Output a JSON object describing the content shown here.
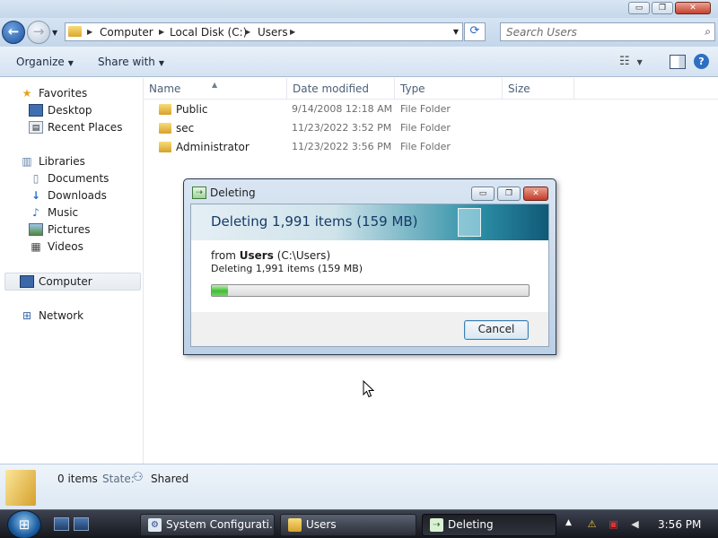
{
  "window": {
    "controls": {
      "minimize": "▭",
      "maximize": "❐",
      "close": "✕"
    }
  },
  "navigation": {
    "back_glyph": "←",
    "forward_glyph": "→",
    "breadcrumbs": [
      "Computer",
      "Local Disk (C:)",
      "Users"
    ],
    "search_placeholder": "Search Users"
  },
  "toolbar": {
    "organize_label": "Organize",
    "share_label": "Share with",
    "help_glyph": "?"
  },
  "nav_pane": {
    "favorites_label": "Favorites",
    "favorites": [
      "Desktop",
      "Recent Places"
    ],
    "libraries_label": "Libraries",
    "libraries": [
      "Documents",
      "Downloads",
      "Music",
      "Pictures",
      "Videos"
    ],
    "computer_label": "Computer",
    "network_label": "Network"
  },
  "file_list": {
    "columns": [
      "Name",
      "Date modified",
      "Type",
      "Size"
    ],
    "rows": [
      {
        "name": "Public",
        "date": "9/14/2008 12:18 AM",
        "type": "File Folder"
      },
      {
        "name": "sec",
        "date": "11/23/2022 3:52 PM",
        "type": "File Folder"
      },
      {
        "name": "Administrator",
        "date": "11/23/2022 3:56 PM",
        "type": "File Folder"
      }
    ]
  },
  "details_pane": {
    "items_count": "0 items",
    "state_label": "State:",
    "state_value": "Shared"
  },
  "dialog": {
    "title": "Deleting",
    "heading": "Deleting 1,991 items (159 MB)",
    "from_prefix": "from",
    "from_folder": "Users",
    "from_path": "(C:\\Users)",
    "status": "Deleting 1,991 items (159 MB)",
    "progress": 0.05,
    "cancel_label": "Cancel"
  },
  "taskbar": {
    "tasks": [
      {
        "label": "System Configurati..."
      },
      {
        "label": "Users"
      },
      {
        "label": "Deleting"
      }
    ],
    "clock": "3:56 PM"
  },
  "colors": {
    "accent": "#2f6fc1",
    "progress": "#3fbf32",
    "folder": "#d8a12a"
  }
}
